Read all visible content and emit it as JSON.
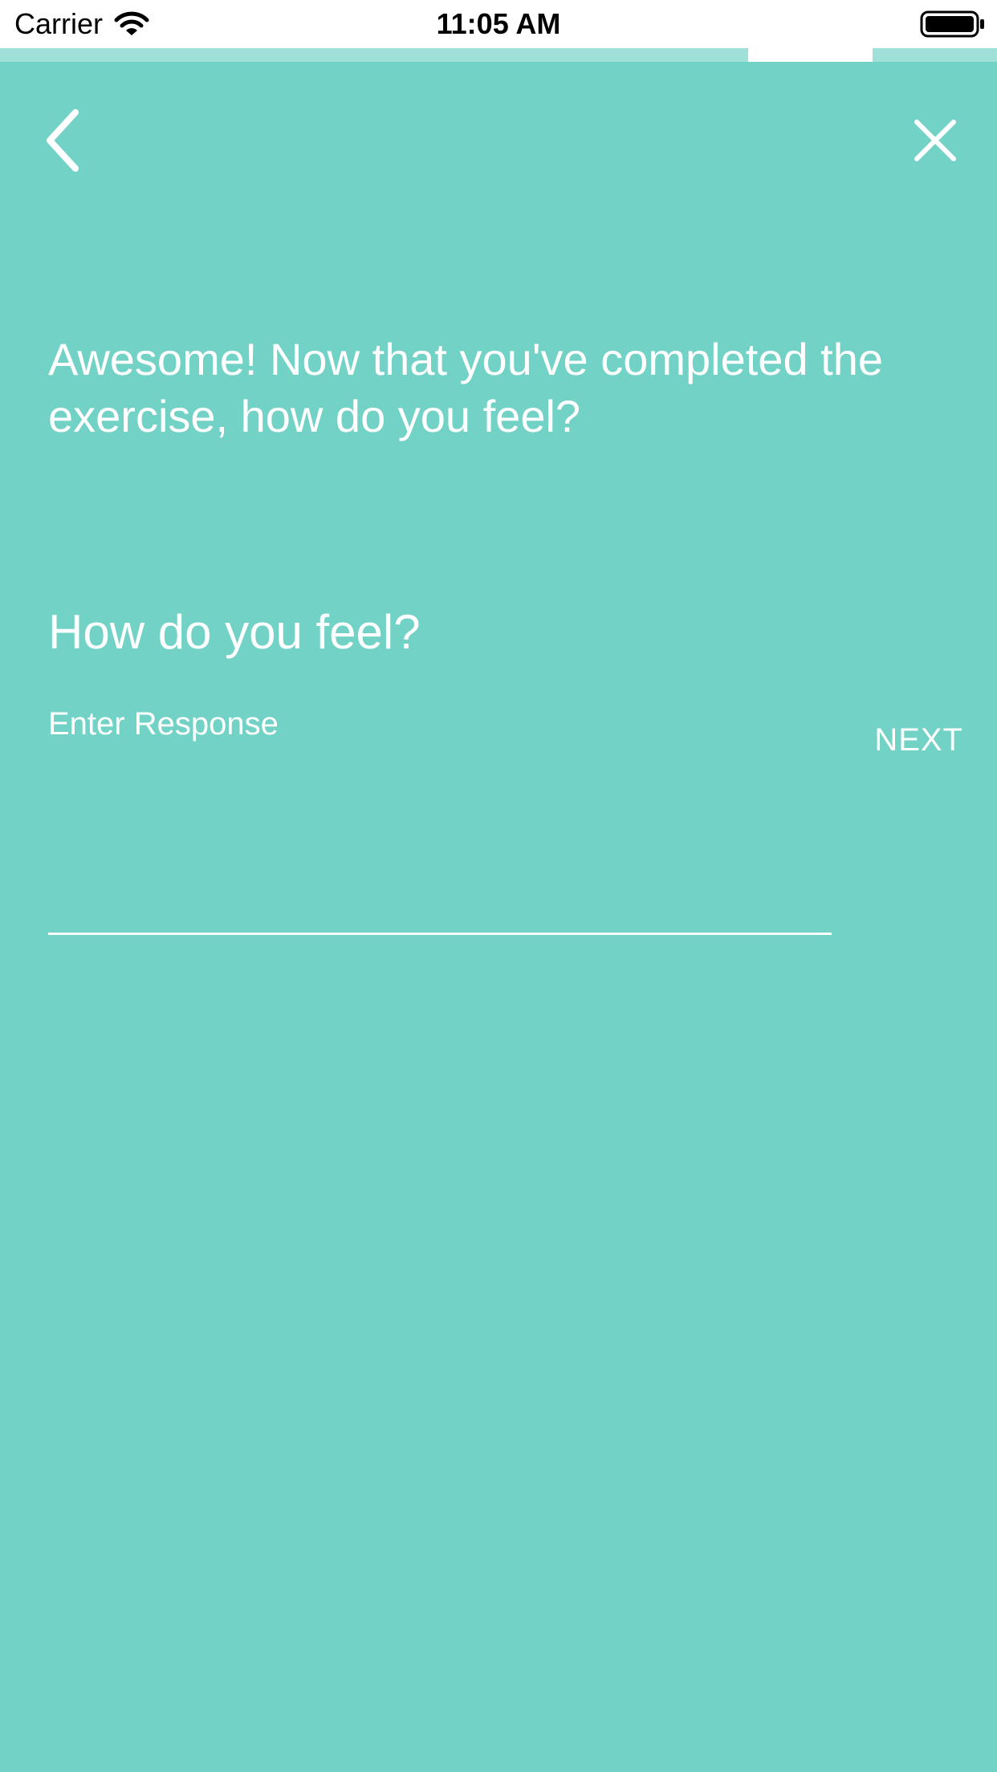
{
  "status_bar": {
    "carrier": "Carrier",
    "time": "11:05 AM",
    "wifi_icon": "wifi-icon",
    "battery_icon": "battery-icon",
    "background_color": "#ffffff"
  },
  "progress": {
    "track_color": "#9fe0d8",
    "marker_color": "#ffffff"
  },
  "nav": {
    "back_icon": "chevron-left-icon",
    "close_icon": "close-icon"
  },
  "content": {
    "intro_text": "Awesome! Now that you've completed the exercise, how do you feel?",
    "question_label": "How do you feel?",
    "response_placeholder": "Enter Response",
    "response_value": "",
    "next_label": "NEXT"
  },
  "colors": {
    "background": "#72d2c6",
    "text": "#ffffff"
  }
}
